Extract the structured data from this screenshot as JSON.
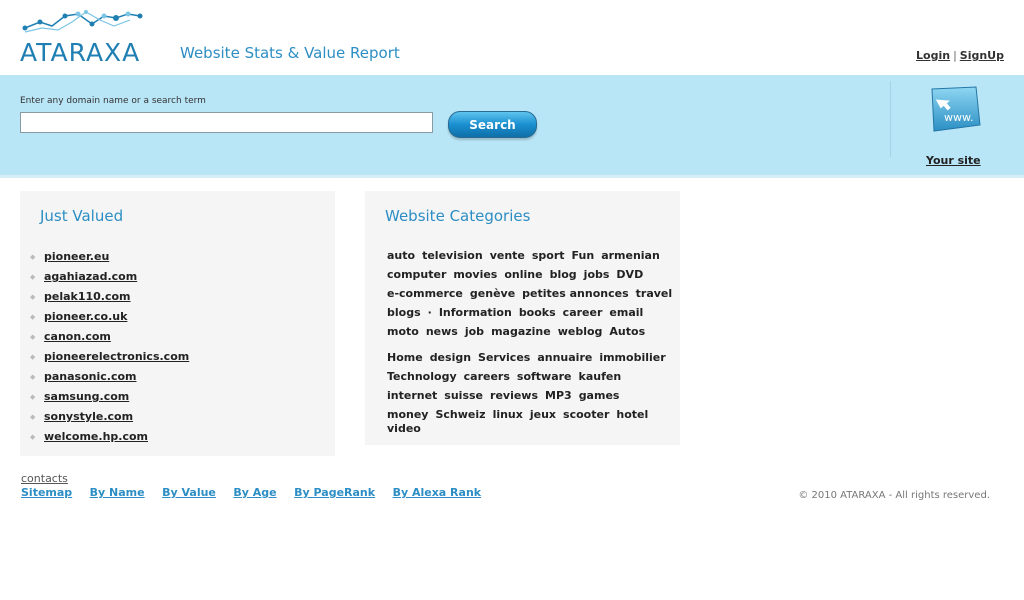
{
  "header": {
    "logo_text": "ATARAXA",
    "tagline": "Website Stats & Value Report",
    "login": "Login",
    "separator": "|",
    "signup": "SignUp"
  },
  "search": {
    "label": "Enter any domain name or a search term",
    "value": "",
    "placeholder": "",
    "button": "Search"
  },
  "your_site": {
    "icon_text": "www.",
    "label": "Your site"
  },
  "just_valued": {
    "title": "Just Valued",
    "items": [
      "pioneer.eu",
      "agahiazad.com",
      "pelak110.com",
      "pioneer.co.uk",
      "canon.com",
      "pioneerelectronics.com",
      "panasonic.com",
      "samsung.com",
      "sonystyle.com",
      "welcome.hp.com"
    ]
  },
  "categories": {
    "title": "Website Categories",
    "lines": [
      [
        "auto",
        "television",
        "vente",
        "sport",
        "Fun",
        "armenian"
      ],
      [
        "computer",
        "movies",
        "online",
        "blog",
        "jobs",
        "DVD"
      ],
      [
        "e-commerce",
        "genève",
        "petites annonces",
        "travel"
      ],
      [
        "blogs",
        "·",
        "Information",
        "books",
        "career",
        "email"
      ],
      [
        "moto",
        "news",
        "job",
        "magazine",
        "weblog",
        "Autos"
      ],
      [
        "Home",
        "design",
        "Services",
        "annuaire",
        "immobilier"
      ],
      [
        "Technology",
        "careers",
        "software",
        "kaufen"
      ],
      [
        "internet",
        "suisse",
        "reviews",
        "MP3",
        "games"
      ],
      [
        "money",
        "Schweiz",
        "linux",
        "jeux",
        "scooter",
        "hotel"
      ],
      [
        "video"
      ]
    ]
  },
  "footer": {
    "contacts": "contacts",
    "links": [
      "Sitemap",
      "By Name",
      "By Value",
      "By Age",
      "By PageRank",
      "By Alexa Rank"
    ],
    "copyright": "© 2010 ATARAXA - All rights reserved."
  },
  "colors": {
    "accent": "#2c8ec4",
    "band": "#b9e6f7",
    "panel": "#f5f5f5"
  }
}
